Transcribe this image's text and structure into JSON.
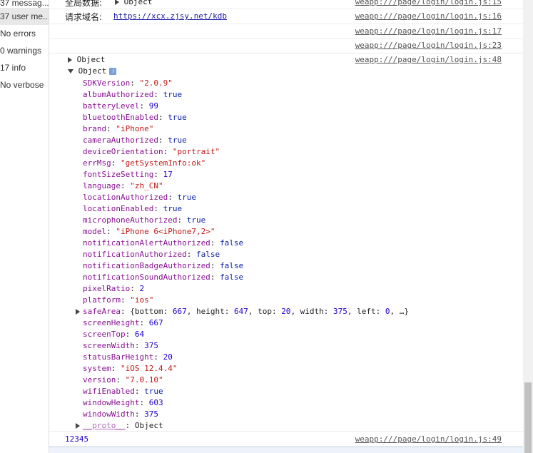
{
  "sidebar": {
    "items": [
      {
        "label": "37 messag..."
      },
      {
        "label": "37 user me..."
      },
      {
        "label": "No errors"
      },
      {
        "label": "0 warnings"
      },
      {
        "label": "17 info"
      },
      {
        "label": "No verbose"
      }
    ]
  },
  "logs": {
    "row1": {
      "label": "全局数据:",
      "value": "Object",
      "link": "weapp:///page/login/login.js:15"
    },
    "row2": {
      "label": "请求域名:",
      "value": "https://xcx.zjsy.net/kdb",
      "link": "weapp:///page/login/login.js:16"
    },
    "row3": {
      "link": "weapp:///page/login/login.js:17"
    },
    "row4": {
      "link": "weapp:///page/login/login.js:23"
    },
    "row5": {
      "value": "Object",
      "link": "weapp:///page/login/login.js:48"
    },
    "expanded_label": "Object",
    "info_icon_glyph": "i",
    "props": [
      {
        "key": "SDKVersion",
        "value": "\"2.0.9\"",
        "type": "string"
      },
      {
        "key": "albumAuthorized",
        "value": "true",
        "type": "bool"
      },
      {
        "key": "batteryLevel",
        "value": "99",
        "type": "number"
      },
      {
        "key": "bluetoothEnabled",
        "value": "true",
        "type": "bool"
      },
      {
        "key": "brand",
        "value": "\"iPhone\"",
        "type": "string"
      },
      {
        "key": "cameraAuthorized",
        "value": "true",
        "type": "bool"
      },
      {
        "key": "deviceOrientation",
        "value": "\"portrait\"",
        "type": "string"
      },
      {
        "key": "errMsg",
        "value": "\"getSystemInfo:ok\"",
        "type": "string"
      },
      {
        "key": "fontSizeSetting",
        "value": "17",
        "type": "number"
      },
      {
        "key": "language",
        "value": "\"zh_CN\"",
        "type": "string"
      },
      {
        "key": "locationAuthorized",
        "value": "true",
        "type": "bool"
      },
      {
        "key": "locationEnabled",
        "value": "true",
        "type": "bool"
      },
      {
        "key": "microphoneAuthorized",
        "value": "true",
        "type": "bool"
      },
      {
        "key": "model",
        "value": "\"iPhone 6<iPhone7,2>\"",
        "type": "string"
      },
      {
        "key": "notificationAlertAuthorized",
        "value": "false",
        "type": "bool"
      },
      {
        "key": "notificationAuthorized",
        "value": "false",
        "type": "bool"
      },
      {
        "key": "notificationBadgeAuthorized",
        "value": "false",
        "type": "bool"
      },
      {
        "key": "notificationSoundAuthorized",
        "value": "false",
        "type": "bool"
      },
      {
        "key": "pixelRatio",
        "value": "2",
        "type": "number"
      },
      {
        "key": "platform",
        "value": "\"ios\"",
        "type": "string"
      },
      {
        "key": "safeArea",
        "value": "{bottom: 667, height: 647, top: 20, width: 375, left: 0, …}",
        "type": "object",
        "expandable": true
      },
      {
        "key": "screenHeight",
        "value": "667",
        "type": "number"
      },
      {
        "key": "screenTop",
        "value": "64",
        "type": "number"
      },
      {
        "key": "screenWidth",
        "value": "375",
        "type": "number"
      },
      {
        "key": "statusBarHeight",
        "value": "20",
        "type": "number"
      },
      {
        "key": "system",
        "value": "\"iOS 12.4.4\"",
        "type": "string"
      },
      {
        "key": "version",
        "value": "\"7.0.10\"",
        "type": "string"
      },
      {
        "key": "wifiEnabled",
        "value": "true",
        "type": "bool"
      },
      {
        "key": "windowHeight",
        "value": "603",
        "type": "number"
      },
      {
        "key": "windowWidth",
        "value": "375",
        "type": "number"
      },
      {
        "key": "__proto__",
        "value": "Object",
        "type": "object",
        "expandable": true
      }
    ],
    "row_num": {
      "value": "12345",
      "link": "weapp:///page/login/login.js:49"
    }
  },
  "colors": {
    "key": "#881391",
    "string": "#c41a16",
    "number": "#1c00cf",
    "bool": "#0d22aa"
  }
}
